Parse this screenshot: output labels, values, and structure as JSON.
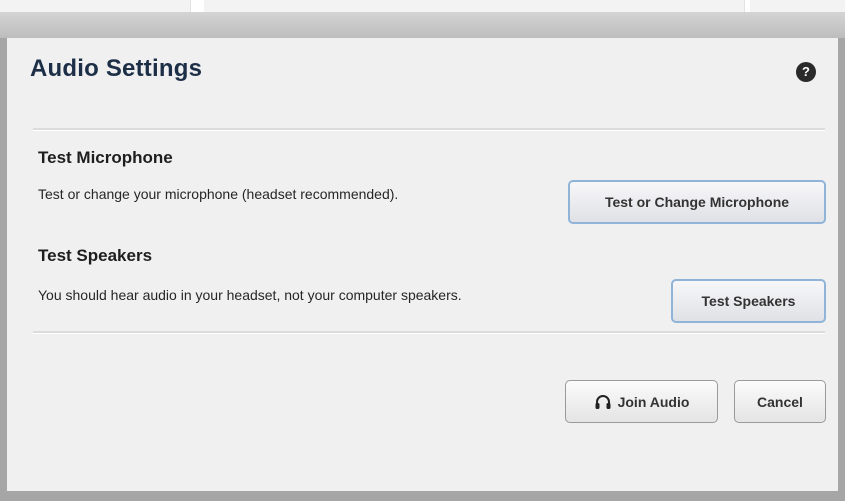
{
  "dialog": {
    "title": "Audio Settings",
    "help_icon_glyph": "?",
    "icons": {
      "help": "help-icon",
      "headset": "headset-icon"
    }
  },
  "microphone": {
    "heading": "Test Microphone",
    "description": "Test or change your microphone (headset recommended).",
    "button_label": "Test or Change Microphone"
  },
  "speakers": {
    "heading": "Test Speakers",
    "description": "You should hear audio in your headset, not your computer speakers.",
    "button_label": "Test Speakers"
  },
  "footer": {
    "join_label": "Join Audio",
    "cancel_label": "Cancel"
  },
  "colors": {
    "title": "#1c2f47",
    "button_border_accent": "#8fb4d8",
    "dialog_background": "#f0f0f0",
    "frame": "#a6a6a6"
  }
}
